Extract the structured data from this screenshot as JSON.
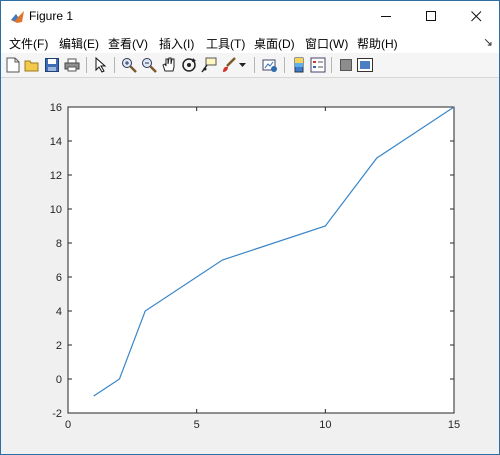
{
  "window": {
    "title": "Figure 1"
  },
  "menu": {
    "items": [
      "文件(F)",
      "编辑(E)",
      "查看(V)",
      "插入(I)",
      "工具(T)",
      "桌面(D)",
      "窗口(W)",
      "帮助(H)"
    ],
    "dock_glyph": "↘"
  },
  "toolbar": {
    "icons": [
      "new-figure-icon",
      "open-file-icon",
      "save-icon",
      "print-icon",
      "edit-plot-icon",
      "zoom-in-icon",
      "zoom-out-icon",
      "pan-icon",
      "rotate-3d-icon",
      "data-cursor-icon",
      "brush-icon",
      "brush-dropdown-icon",
      "link-plot-icon",
      "insert-colorbar-icon",
      "insert-legend-icon",
      "hide-plot-tools-icon",
      "show-plot-tools-icon"
    ]
  },
  "chart_data": {
    "type": "line",
    "x": [
      1,
      2,
      3,
      6,
      10,
      12,
      15
    ],
    "y": [
      -1,
      0,
      4,
      7,
      9,
      13,
      16
    ],
    "xlim": [
      0,
      15
    ],
    "ylim": [
      -2,
      16
    ],
    "xticks": [
      0,
      5,
      10,
      15
    ],
    "yticks": [
      -2,
      0,
      2,
      4,
      6,
      8,
      10,
      12,
      14,
      16
    ],
    "line_color": "#3a86c8",
    "grid": false,
    "title": "",
    "xlabel": "",
    "ylabel": ""
  }
}
